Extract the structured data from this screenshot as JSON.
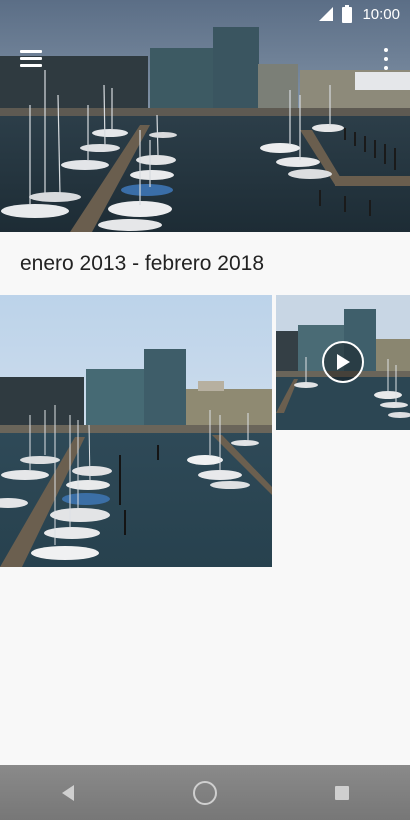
{
  "status_bar": {
    "time": "10:00",
    "icons": [
      "signal-icon",
      "battery-icon"
    ]
  },
  "toolbar": {
    "icons": [
      "menu-icon",
      "more-vert-icon"
    ]
  },
  "album": {
    "title": "enero 2013 - febrero 2018"
  },
  "grid": {
    "items": [
      {
        "kind": "photo",
        "icon": "harbor-photo"
      },
      {
        "kind": "video",
        "icon": "play-icon"
      }
    ]
  },
  "nav_bar": {
    "icons": [
      "back-icon",
      "home-icon",
      "recents-icon"
    ]
  },
  "colors": {
    "background": "#f8f8f8",
    "nav_bar": "#808080",
    "title_text": "#222222"
  }
}
